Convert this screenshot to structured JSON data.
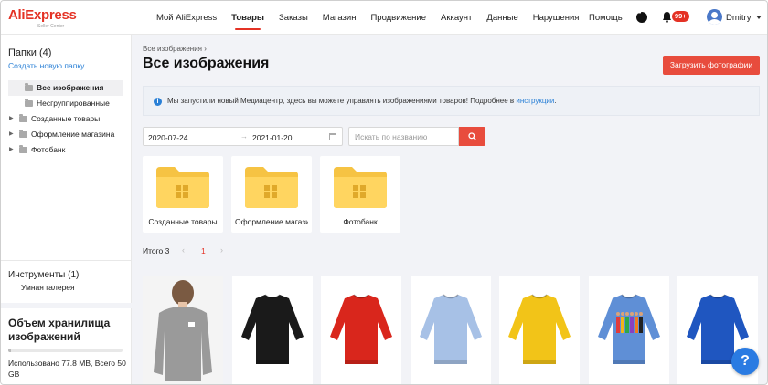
{
  "brand": {
    "logo_text": "AliExpress",
    "logo_sub": "Seller Center",
    "accent": "#e43225"
  },
  "nav": {
    "items": [
      {
        "label": "Мой AliExpress",
        "active": false
      },
      {
        "label": "Товары",
        "active": true
      },
      {
        "label": "Заказы",
        "active": false
      },
      {
        "label": "Магазин",
        "active": false
      },
      {
        "label": "Продвижение",
        "active": false
      },
      {
        "label": "Аккаунт",
        "active": false
      },
      {
        "label": "Данные",
        "active": false
      },
      {
        "label": "Нарушения",
        "active": false
      }
    ],
    "help": "Помощь",
    "badge": "99+",
    "username": "Dmitry"
  },
  "sidebar": {
    "folders_title": "Папки (4)",
    "create_link": "Создать новую папку",
    "tree": [
      {
        "label": "Все изображения",
        "selected": true,
        "expandable": false
      },
      {
        "label": "Несгруппированные",
        "selected": false,
        "expandable": false
      },
      {
        "label": "Созданные товары",
        "selected": false,
        "expandable": true
      },
      {
        "label": "Оформление магазина",
        "selected": false,
        "expandable": true
      },
      {
        "label": "Фотобанк",
        "selected": false,
        "expandable": true
      }
    ],
    "tools_title": "Инструменты (1)",
    "tools_item": "Умная галерея",
    "storage_title": "Объем хранилища изображений",
    "storage_used_fraction": 0.0016,
    "storage_text": "Использовано 77.8 MB, Всего 50 GB"
  },
  "main": {
    "breadcrumb": "Все изображения",
    "title": "Все изображения",
    "upload_label": "Загрузить фотографии",
    "notice": {
      "text": "Мы запустили новый Медиацентр, здесь вы можете управлять изображениями товаров! Подробнее в",
      "link": "инструкции",
      "suffix": "."
    },
    "date_from": "2020-07-24",
    "date_to": "2021-01-20",
    "search_placeholder": "Искать по названию",
    "folders": [
      {
        "label": "Созданные товары"
      },
      {
        "label": "Оформление магазина"
      },
      {
        "label": "Фотобанк"
      }
    ],
    "total_label": "Итого 3",
    "page": "1",
    "images": [
      {
        "type": "model",
        "color": "#9a9a9a"
      },
      {
        "type": "sweater",
        "color": "#1a1a1a"
      },
      {
        "type": "sweater",
        "color": "#d9261c"
      },
      {
        "type": "sweater",
        "color": "#a7c1e6"
      },
      {
        "type": "sweater",
        "color": "#f2c418"
      },
      {
        "type": "print",
        "color": "#5f8fd6"
      },
      {
        "type": "sweater",
        "color": "#1f56c0"
      }
    ]
  },
  "help_fab": "?"
}
